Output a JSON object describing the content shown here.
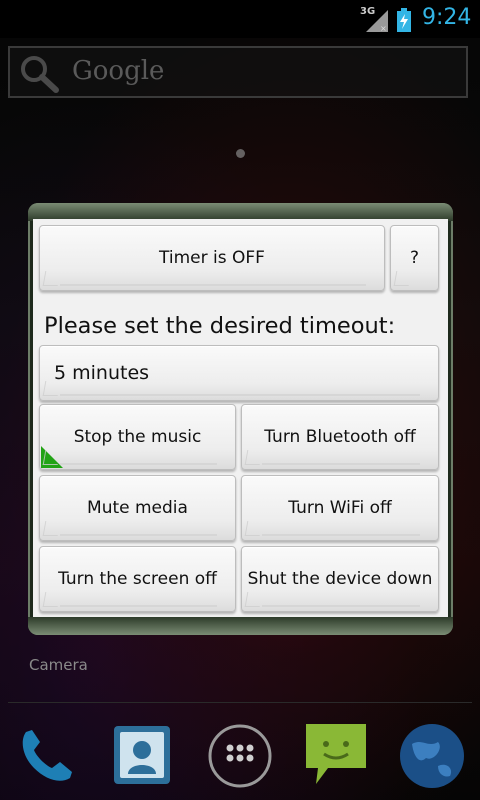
{
  "status_bar": {
    "network": "3G",
    "time": "9:24",
    "accent_color": "#33b5e5"
  },
  "search": {
    "placeholder": "Google"
  },
  "dialog": {
    "timer_button": "Timer is OFF",
    "help_button": "?",
    "heading": "Please set the desired timeout:",
    "timeout_value": "5 minutes",
    "actions": [
      {
        "label": "Stop the music",
        "selected": true
      },
      {
        "label": "Turn Bluetooth off",
        "selected": false
      },
      {
        "label": "Mute media",
        "selected": false
      },
      {
        "label": "Turn WiFi off",
        "selected": false
      },
      {
        "label": "Turn the screen off",
        "selected": false
      },
      {
        "label": "Shut the device down",
        "selected": false
      }
    ],
    "selected_indicator_color": "#22a315"
  },
  "home": {
    "shortcut_label": "Camera"
  },
  "dock": {
    "icons": [
      "phone-icon",
      "contacts-icon",
      "app-drawer-icon",
      "messaging-icon",
      "browser-icon"
    ]
  }
}
